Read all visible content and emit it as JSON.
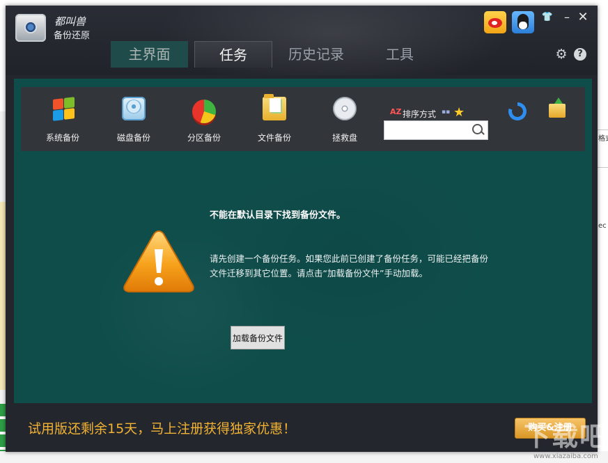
{
  "app": {
    "brand_script": "都叫兽",
    "brand_name": "备份还原"
  },
  "tabs": [
    {
      "label": "主界面"
    },
    {
      "label": "任务"
    },
    {
      "label": "历史记录"
    },
    {
      "label": "工具"
    }
  ],
  "window_controls": {
    "skin": "👕",
    "minimize": "–",
    "close": "✕",
    "settings": "⚙",
    "help": "?"
  },
  "toolbar": {
    "tools": [
      {
        "label": "系统备份",
        "icon": "windows-icon"
      },
      {
        "label": "磁盘备份",
        "icon": "disk-icon"
      },
      {
        "label": "分区备份",
        "icon": "partition-pie-icon"
      },
      {
        "label": "文件备份",
        "icon": "folder-icon"
      },
      {
        "label": "拯救盘",
        "icon": "cd-icon"
      }
    ],
    "sort_label": "排序方式",
    "sort_icon_text": "AZ",
    "search_placeholder": ""
  },
  "message": {
    "title": "不能在默认目录下找到备份文件。",
    "body": "请先创建一个备份任务。如果您此前已创建了备份任务，可能已经把备份文件迁移到其它位置。请点击“加载备份文件”手动加载。",
    "load_button": "加载备份文件"
  },
  "footer": {
    "trial_text": "试用版还剩余15天，马上注册获得独家优惠！",
    "buy_button": "购买&注册"
  },
  "watermark": {
    "text": "下载吧",
    "url": "www.xiazaiba.com"
  },
  "background": {
    "right_texts": [
      "格式",
      "ec"
    ]
  },
  "colors": {
    "content_bg": "#0f4d4b",
    "toolbar_bg": "#323539",
    "window_bg": "#23262d",
    "trial_text": "#f2b233",
    "buy_button": "#e4ab3e"
  }
}
